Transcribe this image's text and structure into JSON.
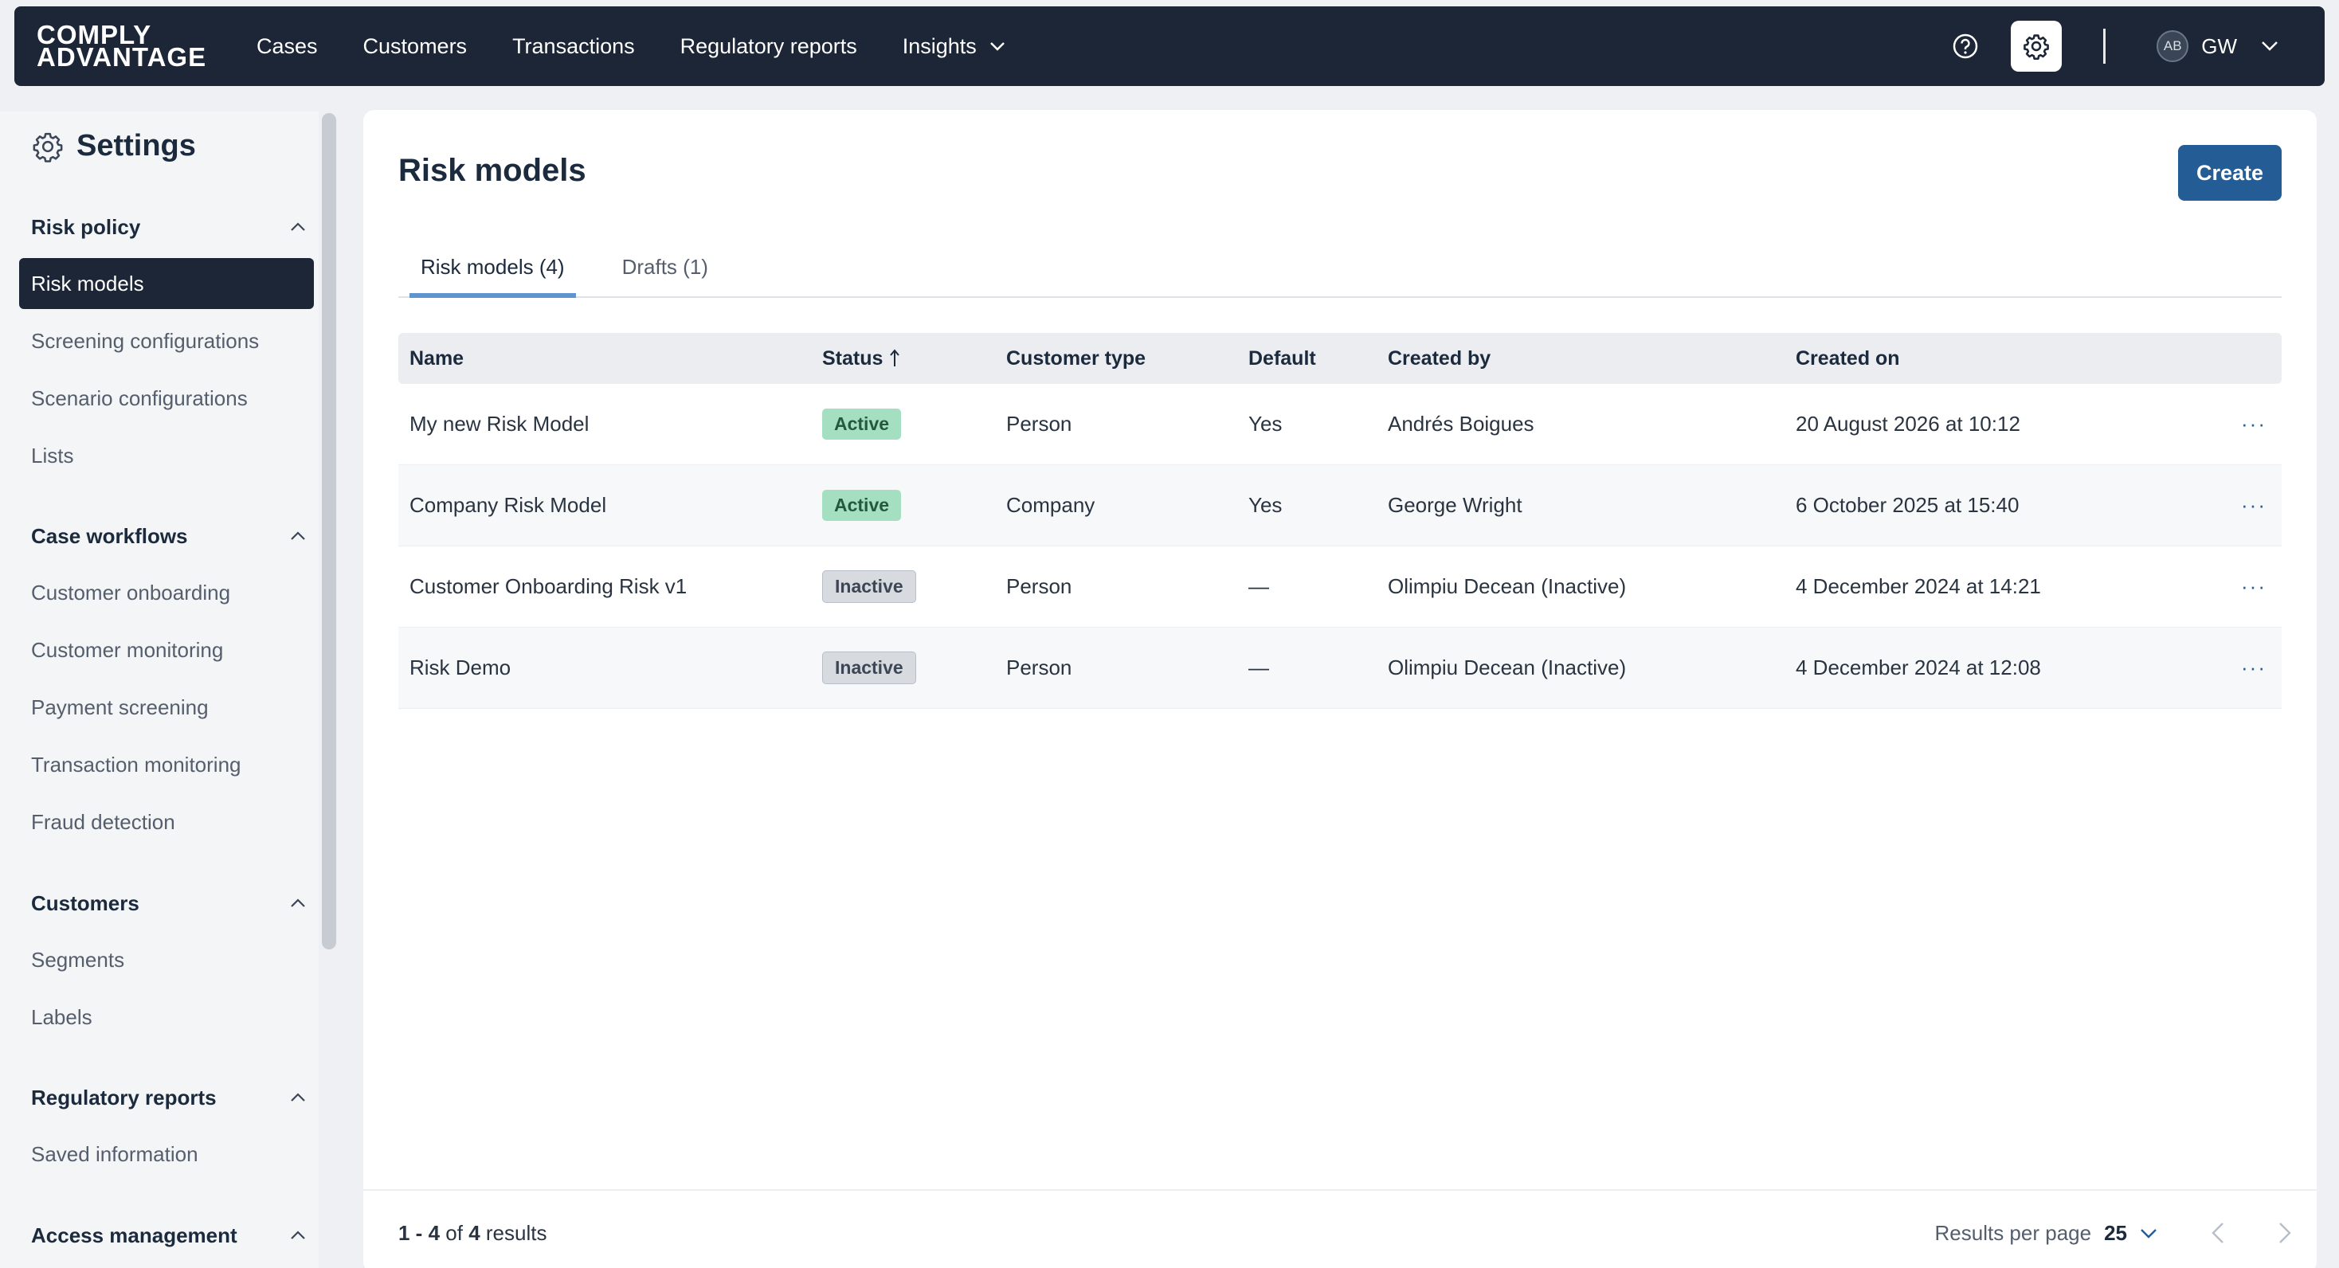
{
  "brand": {
    "line1": "COMPLY",
    "line2": "ADVANTAGE"
  },
  "nav": {
    "items": [
      {
        "label": "Cases"
      },
      {
        "label": "Customers"
      },
      {
        "label": "Transactions"
      },
      {
        "label": "Regulatory reports"
      },
      {
        "label": "Insights"
      }
    ]
  },
  "user": {
    "avatar_initials": "AB",
    "initials": "GW"
  },
  "sidebar": {
    "title": "Settings",
    "groups": [
      {
        "label": "Risk policy",
        "items": [
          "Risk models",
          "Screening configurations",
          "Scenario configurations",
          "Lists"
        ]
      },
      {
        "label": "Case workflows",
        "items": [
          "Customer onboarding",
          "Customer monitoring",
          "Payment screening",
          "Transaction monitoring",
          "Fraud detection"
        ]
      },
      {
        "label": "Customers",
        "items": [
          "Segments",
          "Labels"
        ]
      },
      {
        "label": "Regulatory reports",
        "items": [
          "Saved information"
        ]
      },
      {
        "label": "Access management",
        "items": []
      }
    ],
    "active_item": "Risk models"
  },
  "main": {
    "title": "Risk models",
    "create_label": "Create",
    "tabs": [
      {
        "label": "Risk models (4)",
        "active": true
      },
      {
        "label": "Drafts (1)",
        "active": false
      }
    ],
    "table": {
      "headers": [
        "Name",
        "Status",
        "Customer type",
        "Default",
        "Created by",
        "Created on"
      ],
      "rows": [
        {
          "name": "My new Risk Model",
          "status": "Active",
          "type": "Person",
          "default": "Yes",
          "created_by": "Andrés Boigues",
          "created_on": "20 August 2026 at 10:12"
        },
        {
          "name": "Company Risk Model",
          "status": "Active",
          "type": "Company",
          "default": "Yes",
          "created_by": "George Wright",
          "created_on": "6 October 2025 at 15:40"
        },
        {
          "name": "Customer Onboarding Risk v1",
          "status": "Inactive",
          "type": "Person",
          "default": "—",
          "created_by": "Olimpiu Decean (Inactive)",
          "created_on": "4 December 2024 at 14:21"
        },
        {
          "name": "Risk Demo",
          "status": "Inactive",
          "type": "Person",
          "default": "—",
          "created_by": "Olimpiu Decean (Inactive)",
          "created_on": "4 December 2024 at 12:08"
        }
      ],
      "row_menu_label": "···"
    },
    "pagination": {
      "range": "1 - 4",
      "of_label": "of",
      "total": "4",
      "results_label": "results",
      "per_page_label": "Results per page",
      "per_page_value": "25"
    }
  },
  "colors": {
    "nav_bg": "#1c2636",
    "primary": "#245d96",
    "active_badge": "#a5dfc1",
    "inactive_badge": "#d7dbe0",
    "tab_underline": "#5e95cf"
  }
}
